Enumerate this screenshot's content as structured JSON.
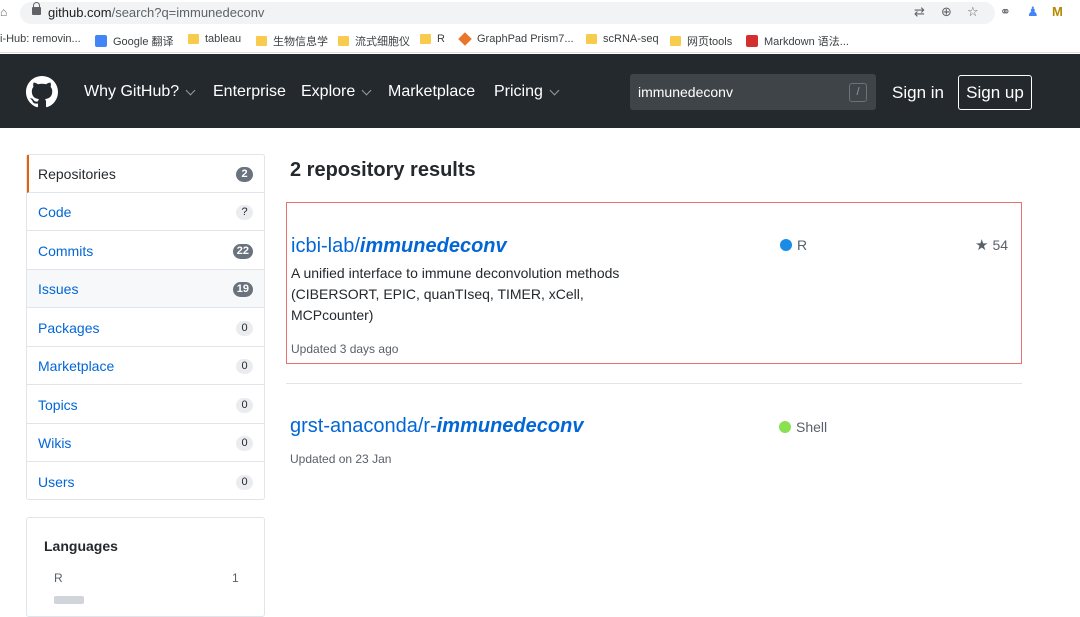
{
  "browser": {
    "url_host": "github.com",
    "url_path": "/search?q=immunedeconv",
    "bookmarks": [
      {
        "label": "i-Hub: removin...",
        "icon": "none"
      },
      {
        "label": "Google 翻译",
        "icon": "google-translate-icon"
      },
      {
        "label": "tableau",
        "icon": "folder-icon"
      },
      {
        "label": "生物信息学",
        "icon": "folder-icon"
      },
      {
        "label": "流式细胞仪",
        "icon": "folder-icon"
      },
      {
        "label": "R",
        "icon": "folder-icon"
      },
      {
        "label": "GraphPad Prism7...",
        "icon": "graphpad-icon"
      },
      {
        "label": "scRNA-seq",
        "icon": "folder-icon"
      },
      {
        "label": "网页tools",
        "icon": "folder-icon"
      },
      {
        "label": "Markdown 语法...",
        "icon": "csdn-icon"
      }
    ]
  },
  "header": {
    "nav": [
      {
        "label": "Why GitHub?",
        "dropdown": true
      },
      {
        "label": "Enterprise",
        "dropdown": false
      },
      {
        "label": "Explore",
        "dropdown": true
      },
      {
        "label": "Marketplace",
        "dropdown": false
      },
      {
        "label": "Pricing",
        "dropdown": true
      }
    ],
    "search_value": "immunedeconv",
    "search_shortcut": "/",
    "sign_in": "Sign in",
    "sign_up": "Sign up"
  },
  "sidebar": {
    "items": [
      {
        "label": "Repositories",
        "count": "2",
        "selected": true
      },
      {
        "label": "Code",
        "count": "?"
      },
      {
        "label": "Commits",
        "count": "22"
      },
      {
        "label": "Issues",
        "count": "19"
      },
      {
        "label": "Packages",
        "count": "0"
      },
      {
        "label": "Marketplace",
        "count": "0"
      },
      {
        "label": "Topics",
        "count": "0"
      },
      {
        "label": "Wikis",
        "count": "0"
      },
      {
        "label": "Users",
        "count": "0"
      }
    ],
    "languages": {
      "title": "Languages",
      "items": [
        {
          "label": "R",
          "count": "1"
        }
      ]
    }
  },
  "results": {
    "title": "2 repository results",
    "items": [
      {
        "owner": "icbi-lab/",
        "name": "immunedeconv",
        "description": "A unified interface to immune deconvolution methods (CIBERSORT, EPIC, quanTIseq, TIMER, xCell, MCPcounter)",
        "updated": "Updated 3 days ago",
        "language": "R",
        "language_color": "#198ce7",
        "stars": "54"
      },
      {
        "owner": "grst-anaconda/r-",
        "name": "immunedeconv",
        "description": "",
        "updated": "Updated on 23 Jan",
        "language": "Shell",
        "language_color": "#89e051",
        "stars": ""
      }
    ]
  },
  "colors": {
    "header_bg": "#24292e",
    "link": "#0366d6",
    "selected_accent": "#e36209",
    "highlight_box": "#e8706f"
  }
}
